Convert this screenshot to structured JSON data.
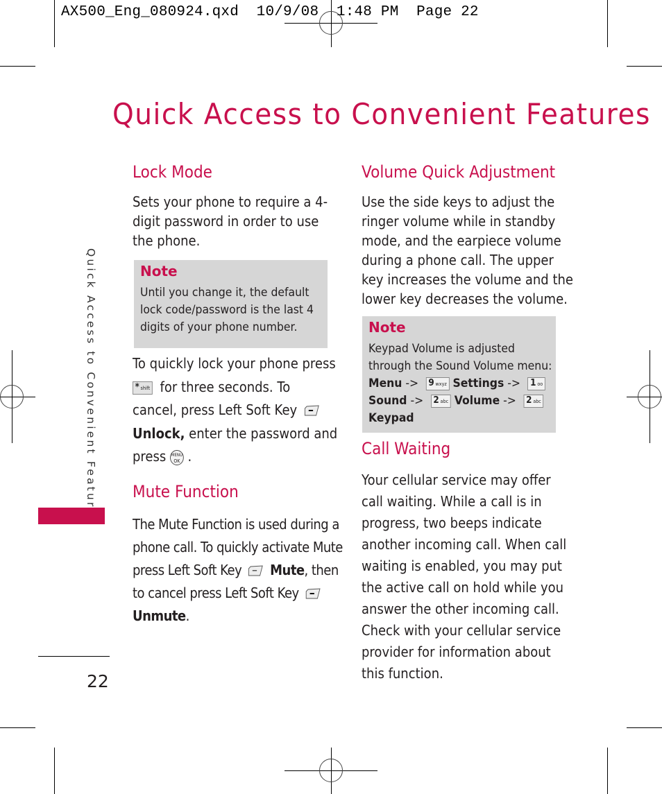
{
  "slug": {
    "filename": "AX500_Eng_080924.qxd",
    "date": "10/9/08",
    "time": "1:48 PM",
    "page_label": "Page 22"
  },
  "page_title": "Quick Access to Convenient Features",
  "side_tab": {
    "label": "Quick Access to Convenient Features",
    "accent_color": "#c8104d"
  },
  "page_number": "22",
  "left_column": {
    "lock_mode": {
      "heading": "Lock Mode",
      "paragraph_lines": [
        "Sets your phone to require a 4-",
        "digit password in order to use",
        "the phone."
      ],
      "note": {
        "title": "Note",
        "lines": [
          "Until you change it, the default",
          "lock code/password is the last 4",
          "digits of your phone number."
        ]
      },
      "instructions": {
        "line1": "To quickly lock your phone press",
        "key_star_label": "*",
        "key_star_sub": "shift",
        "line2": "for three seconds. To",
        "line3": "cancel, press Left Soft Key",
        "unlock_bold": "Unlock,",
        "line4": "enter the password and",
        "line5_pre": "press",
        "ok_key_top": "MENU",
        "ok_key_bottom": "OK",
        "line5_post": "."
      }
    },
    "mute_function": {
      "heading": "Mute Function",
      "line1": "The Mute Function is used during a",
      "line2": "phone call. To quickly activate Mute",
      "line3_pre": "press Left Soft Key",
      "mute_bold": "Mute",
      "line3_post": ", then",
      "line4": "to cancel press Left Soft Key",
      "unmute_bold": "Unmute",
      "line5_post": "."
    }
  },
  "right_column": {
    "volume_quick_adjustment": {
      "heading": "Volume Quick Adjustment",
      "paragraph_lines": [
        "Use the side keys to adjust the",
        "ringer volume while in standby",
        "mode, and the earpiece volume",
        "during a phone call. The upper",
        "key increases the volume and the",
        "lower key decreases the volume."
      ],
      "note": {
        "title": "Note",
        "line1": "Keypad Volume is adjusted",
        "line2": "through the Sound Volume menu:",
        "menu_bold": "Menu",
        "arrow": "->",
        "key9": "9",
        "key9_sub": "wxyz",
        "settings_bold": "Settings",
        "key1": "1",
        "key1_sub": "oo",
        "sound_bold": "Sound",
        "key2": "2",
        "key2_sub": "abc",
        "volume_bold": "Volume",
        "keypad_bold": "Keypad"
      }
    },
    "call_waiting": {
      "heading": "Call Waiting",
      "paragraph_lines": [
        "Your cellular service may offer",
        "call waiting. While a call is in",
        "progress, two beeps indicate",
        "another incoming call. When call",
        "waiting is enabled, you may put",
        "the active call on hold while you",
        "answer the other incoming call.",
        "Check with your cellular service",
        "provider for information about",
        "this function."
      ]
    }
  }
}
